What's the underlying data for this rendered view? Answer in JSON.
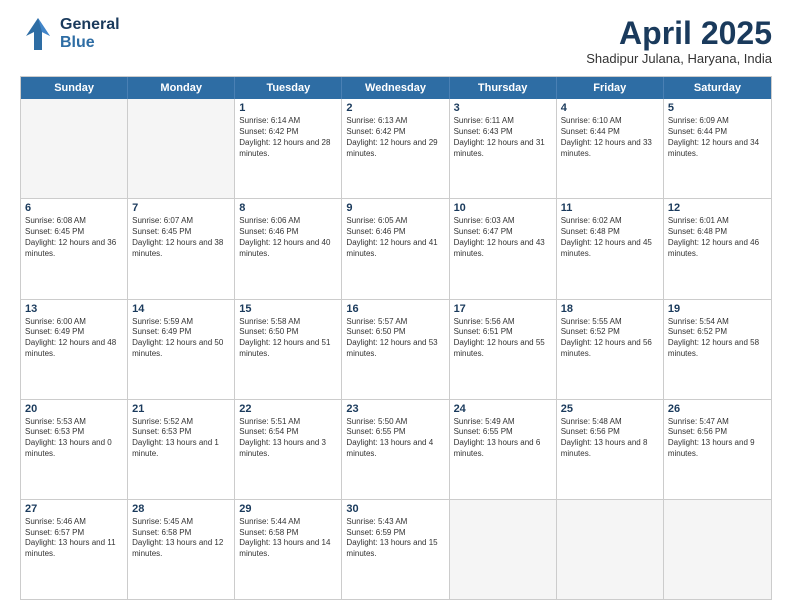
{
  "header": {
    "logo": {
      "general": "General",
      "blue": "Blue"
    },
    "title": "April 2025",
    "subtitle": "Shadipur Julana, Haryana, India"
  },
  "weekdays": [
    "Sunday",
    "Monday",
    "Tuesday",
    "Wednesday",
    "Thursday",
    "Friday",
    "Saturday"
  ],
  "weeks": [
    [
      {
        "day": "",
        "empty": true
      },
      {
        "day": "",
        "empty": true
      },
      {
        "day": "1",
        "sunrise": "Sunrise: 6:14 AM",
        "sunset": "Sunset: 6:42 PM",
        "daylight": "Daylight: 12 hours and 28 minutes."
      },
      {
        "day": "2",
        "sunrise": "Sunrise: 6:13 AM",
        "sunset": "Sunset: 6:42 PM",
        "daylight": "Daylight: 12 hours and 29 minutes."
      },
      {
        "day": "3",
        "sunrise": "Sunrise: 6:11 AM",
        "sunset": "Sunset: 6:43 PM",
        "daylight": "Daylight: 12 hours and 31 minutes."
      },
      {
        "day": "4",
        "sunrise": "Sunrise: 6:10 AM",
        "sunset": "Sunset: 6:44 PM",
        "daylight": "Daylight: 12 hours and 33 minutes."
      },
      {
        "day": "5",
        "sunrise": "Sunrise: 6:09 AM",
        "sunset": "Sunset: 6:44 PM",
        "daylight": "Daylight: 12 hours and 34 minutes."
      }
    ],
    [
      {
        "day": "6",
        "sunrise": "Sunrise: 6:08 AM",
        "sunset": "Sunset: 6:45 PM",
        "daylight": "Daylight: 12 hours and 36 minutes."
      },
      {
        "day": "7",
        "sunrise": "Sunrise: 6:07 AM",
        "sunset": "Sunset: 6:45 PM",
        "daylight": "Daylight: 12 hours and 38 minutes."
      },
      {
        "day": "8",
        "sunrise": "Sunrise: 6:06 AM",
        "sunset": "Sunset: 6:46 PM",
        "daylight": "Daylight: 12 hours and 40 minutes."
      },
      {
        "day": "9",
        "sunrise": "Sunrise: 6:05 AM",
        "sunset": "Sunset: 6:46 PM",
        "daylight": "Daylight: 12 hours and 41 minutes."
      },
      {
        "day": "10",
        "sunrise": "Sunrise: 6:03 AM",
        "sunset": "Sunset: 6:47 PM",
        "daylight": "Daylight: 12 hours and 43 minutes."
      },
      {
        "day": "11",
        "sunrise": "Sunrise: 6:02 AM",
        "sunset": "Sunset: 6:48 PM",
        "daylight": "Daylight: 12 hours and 45 minutes."
      },
      {
        "day": "12",
        "sunrise": "Sunrise: 6:01 AM",
        "sunset": "Sunset: 6:48 PM",
        "daylight": "Daylight: 12 hours and 46 minutes."
      }
    ],
    [
      {
        "day": "13",
        "sunrise": "Sunrise: 6:00 AM",
        "sunset": "Sunset: 6:49 PM",
        "daylight": "Daylight: 12 hours and 48 minutes."
      },
      {
        "day": "14",
        "sunrise": "Sunrise: 5:59 AM",
        "sunset": "Sunset: 6:49 PM",
        "daylight": "Daylight: 12 hours and 50 minutes."
      },
      {
        "day": "15",
        "sunrise": "Sunrise: 5:58 AM",
        "sunset": "Sunset: 6:50 PM",
        "daylight": "Daylight: 12 hours and 51 minutes."
      },
      {
        "day": "16",
        "sunrise": "Sunrise: 5:57 AM",
        "sunset": "Sunset: 6:50 PM",
        "daylight": "Daylight: 12 hours and 53 minutes."
      },
      {
        "day": "17",
        "sunrise": "Sunrise: 5:56 AM",
        "sunset": "Sunset: 6:51 PM",
        "daylight": "Daylight: 12 hours and 55 minutes."
      },
      {
        "day": "18",
        "sunrise": "Sunrise: 5:55 AM",
        "sunset": "Sunset: 6:52 PM",
        "daylight": "Daylight: 12 hours and 56 minutes."
      },
      {
        "day": "19",
        "sunrise": "Sunrise: 5:54 AM",
        "sunset": "Sunset: 6:52 PM",
        "daylight": "Daylight: 12 hours and 58 minutes."
      }
    ],
    [
      {
        "day": "20",
        "sunrise": "Sunrise: 5:53 AM",
        "sunset": "Sunset: 6:53 PM",
        "daylight": "Daylight: 13 hours and 0 minutes."
      },
      {
        "day": "21",
        "sunrise": "Sunrise: 5:52 AM",
        "sunset": "Sunset: 6:53 PM",
        "daylight": "Daylight: 13 hours and 1 minute."
      },
      {
        "day": "22",
        "sunrise": "Sunrise: 5:51 AM",
        "sunset": "Sunset: 6:54 PM",
        "daylight": "Daylight: 13 hours and 3 minutes."
      },
      {
        "day": "23",
        "sunrise": "Sunrise: 5:50 AM",
        "sunset": "Sunset: 6:55 PM",
        "daylight": "Daylight: 13 hours and 4 minutes."
      },
      {
        "day": "24",
        "sunrise": "Sunrise: 5:49 AM",
        "sunset": "Sunset: 6:55 PM",
        "daylight": "Daylight: 13 hours and 6 minutes."
      },
      {
        "day": "25",
        "sunrise": "Sunrise: 5:48 AM",
        "sunset": "Sunset: 6:56 PM",
        "daylight": "Daylight: 13 hours and 8 minutes."
      },
      {
        "day": "26",
        "sunrise": "Sunrise: 5:47 AM",
        "sunset": "Sunset: 6:56 PM",
        "daylight": "Daylight: 13 hours and 9 minutes."
      }
    ],
    [
      {
        "day": "27",
        "sunrise": "Sunrise: 5:46 AM",
        "sunset": "Sunset: 6:57 PM",
        "daylight": "Daylight: 13 hours and 11 minutes."
      },
      {
        "day": "28",
        "sunrise": "Sunrise: 5:45 AM",
        "sunset": "Sunset: 6:58 PM",
        "daylight": "Daylight: 13 hours and 12 minutes."
      },
      {
        "day": "29",
        "sunrise": "Sunrise: 5:44 AM",
        "sunset": "Sunset: 6:58 PM",
        "daylight": "Daylight: 13 hours and 14 minutes."
      },
      {
        "day": "30",
        "sunrise": "Sunrise: 5:43 AM",
        "sunset": "Sunset: 6:59 PM",
        "daylight": "Daylight: 13 hours and 15 minutes."
      },
      {
        "day": "",
        "empty": true
      },
      {
        "day": "",
        "empty": true
      },
      {
        "day": "",
        "empty": true
      }
    ]
  ]
}
